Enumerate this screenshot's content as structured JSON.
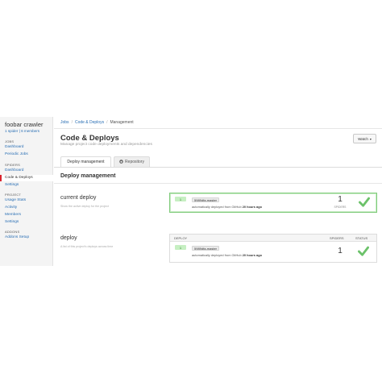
{
  "sidebar": {
    "project_title": "foobar crawler",
    "project_sub": "1 spider | 6 members",
    "sections": [
      {
        "heading": "JOBS",
        "items": [
          "Dashboard",
          "Periodic Jobs"
        ]
      },
      {
        "heading": "SPIDERS",
        "items": [
          "Dashboard",
          "Code & Deploys",
          "Settings"
        ]
      },
      {
        "heading": "PROJECT",
        "items": [
          "Usage Stats",
          "Activity",
          "Members",
          "Settings"
        ]
      },
      {
        "heading": "ADDONS",
        "items": [
          "Addons Setup"
        ]
      }
    ],
    "active_item": "Code & Deploys"
  },
  "breadcrumb": [
    "Jobs",
    "Code & Deploys",
    "Management"
  ],
  "page": {
    "title": "Code & Deploys",
    "subtitle": "Manage project code deployments and dependencies",
    "watch_label": "Watch",
    "watch_icon": "caret-down-icon"
  },
  "tabs": [
    {
      "label": "Deploy management",
      "active": true
    },
    {
      "label": "Repository",
      "icon": "github-icon",
      "active": false
    }
  ],
  "section_title": "Deploy management",
  "current_deploy": {
    "label": "current deploy",
    "help": "Show the active deploy for the project",
    "number": "1",
    "tag": "5989dfa-master",
    "desc_prefix": "automatically deployed from GitHub",
    "desc_time": "20 hours ago",
    "spiders": "1",
    "spiders_label": "SPIDERS"
  },
  "deploy_list": {
    "label": "deploy",
    "help": "A list of this project's deploys across time",
    "headers": {
      "deploy": "DEPLOY",
      "spiders": "SPIDERS",
      "status": "STATUS"
    },
    "rows": [
      {
        "number": "1",
        "tag": "5989dfa-master",
        "desc_prefix": "automatically deployed from GitHub",
        "desc_time": "20 hours ago",
        "spiders": "1"
      }
    ]
  },
  "colors": {
    "accent_red": "#d9232e",
    "success_green": "#6cc26a",
    "link_blue": "#2a6fb4"
  }
}
